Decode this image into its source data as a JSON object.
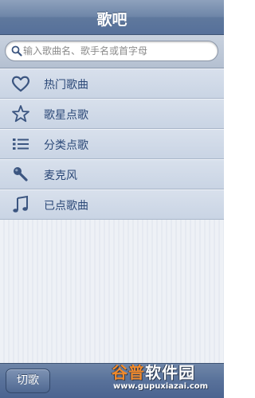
{
  "header": {
    "title": "歌吧"
  },
  "search": {
    "placeholder": "输入歌曲名、歌手名或首字母",
    "value": "",
    "icon": "search-icon"
  },
  "menu": {
    "items": [
      {
        "label": "热门歌曲",
        "icon": "heart-icon"
      },
      {
        "label": "歌星点歌",
        "icon": "star-icon"
      },
      {
        "label": "分类点歌",
        "icon": "list-icon"
      },
      {
        "label": "麦克风",
        "icon": "microphone-icon"
      },
      {
        "label": "已点歌曲",
        "icon": "music-note-icon"
      }
    ]
  },
  "footer": {
    "cut_label": "切歌"
  },
  "watermark": {
    "brand_accent": "谷普",
    "brand_rest": "软件园",
    "url": "www.gupuxiazai.com"
  },
  "colors": {
    "nav_bar": "#6e86a8",
    "menu_label": "#2c4978",
    "menu_icon": "#3b5580",
    "watermark_accent": "#f08a2c"
  }
}
